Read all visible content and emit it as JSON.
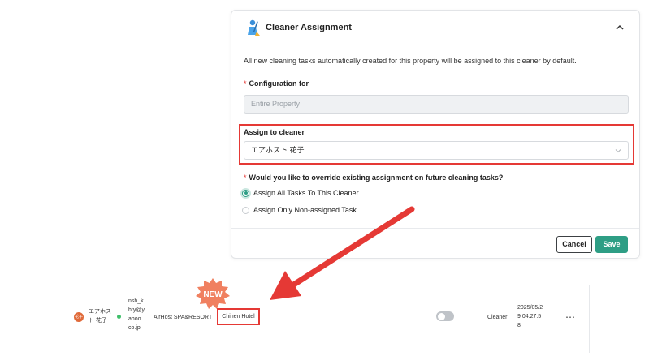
{
  "panel": {
    "title": "Cleaner Assignment",
    "description": "All new cleaning tasks automatically created for this property will be assigned to this cleaner by default.",
    "required_mark": "*",
    "config_label": "Configuration for",
    "config_value": "Entire Property",
    "assign_label": "Assign to cleaner",
    "assign_value": "エアホスト 花子",
    "override_question": "Would you like to override existing assignment on future cleaning tasks?",
    "options": [
      {
        "label": "Assign All Tasks To This Cleaner",
        "selected": true
      },
      {
        "label": "Assign Only Non-assigned Task",
        "selected": false
      }
    ],
    "cancel_label": "Cancel",
    "save_label": "Save"
  },
  "row": {
    "avatar_text": "花子",
    "name_line1": "エアホス",
    "name_line2": "ト 花子",
    "email_lines": [
      "nsh_k",
      "hty@y",
      "ahoo.",
      "co.jp"
    ],
    "company": "AirHost SPA&RESORT",
    "property": "Chinen Hotel",
    "new_badge": "NEW",
    "role": "Cleaner",
    "date_lines": [
      "2025/05/2",
      "9 04:27:5",
      "8"
    ],
    "more": "⋯"
  },
  "colors": {
    "accent": "#2e9e85",
    "highlight": "#e53935",
    "badge": "#f08060"
  }
}
